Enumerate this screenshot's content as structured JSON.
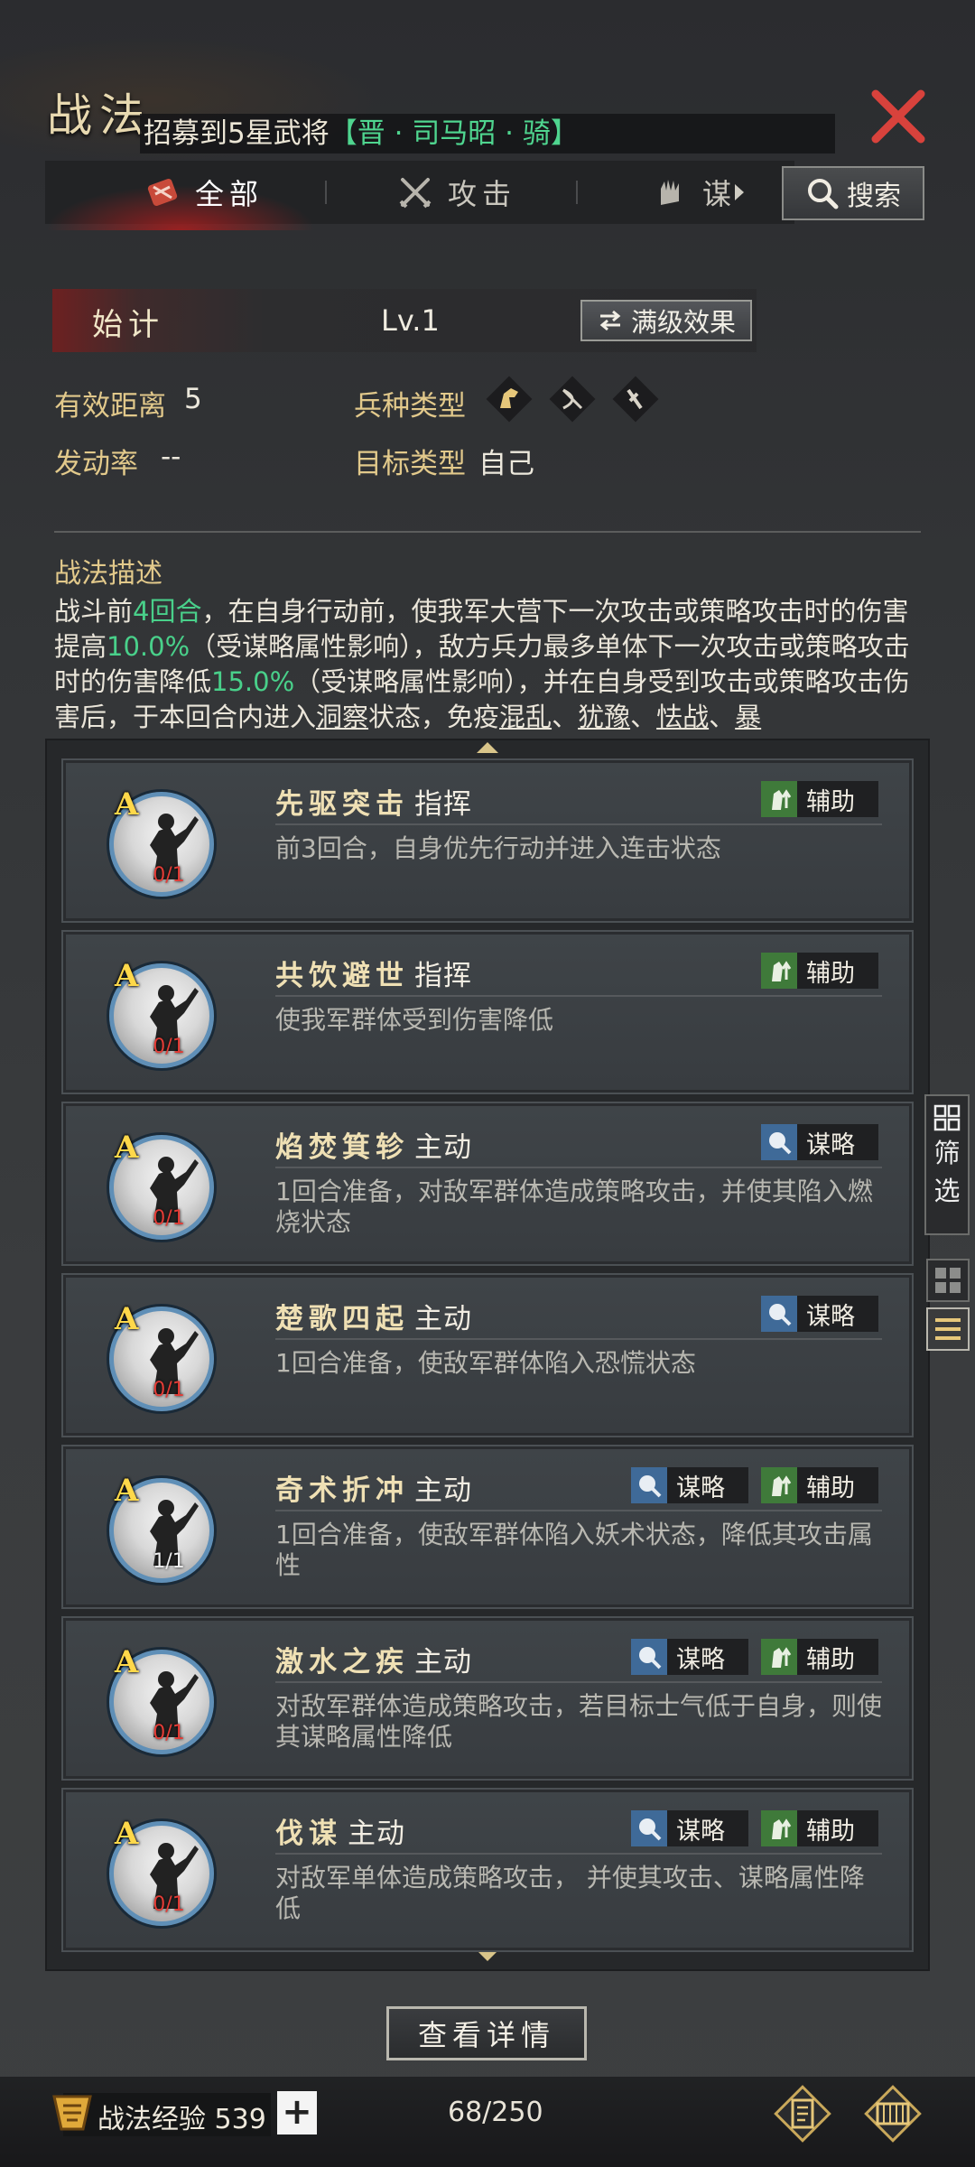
{
  "header": {
    "title": "战法",
    "marquee_prefix": "招募到5星武将",
    "marquee_highlight": "【晋 · 司马昭 · 骑】"
  },
  "tabs": [
    {
      "label": "全部",
      "active": true
    },
    {
      "label": "攻击",
      "active": false
    },
    {
      "label": "谋",
      "active": false
    }
  ],
  "search_label": "搜索",
  "skill": {
    "name": "始计",
    "level": "Lv.1",
    "max_effect_label": "满级效果",
    "range_label": "有效距离",
    "range_value": "5",
    "troop_label": "兵种类型",
    "rate_label": "发动率",
    "rate_value": "--",
    "target_label": "目标类型",
    "target_value": "自己",
    "desc_title": "战法描述",
    "desc_parts": {
      "p1": "战斗前",
      "g1": "4回合",
      "p2": "，在自身行动前，使我军大营下一次攻击或策略攻击时的伤害提高",
      "g2": "10.0%",
      "p3": "（受谋略属性影响），敌方兵力最多单体下一次攻击或策略攻击时的伤害降低",
      "g3": "15.0%",
      "p4": "（受谋略属性影响），并在自身受到攻击或策略攻击伤害后，于本回合内进入",
      "u1": "洞察",
      "p5": "状态，免疫",
      "u2": "混乱",
      "p6": "、",
      "u3": "犹豫",
      "p7": "、",
      "u4": "怯战",
      "p8": "、",
      "u5": "暴"
    }
  },
  "cards": [
    {
      "grade": "A",
      "name": "先驱突击",
      "type": "指挥",
      "desc": "前3回合，自身优先行动并进入连击状态",
      "count": "0/1",
      "tags": [
        "辅助"
      ]
    },
    {
      "grade": "A",
      "name": "共饮避世",
      "type": "指挥",
      "desc": "使我军群体受到伤害降低",
      "count": "0/1",
      "tags": [
        "辅助"
      ]
    },
    {
      "grade": "A",
      "name": "焰焚箕轸",
      "type": "主动",
      "desc": "1回合准备，对敌军群体造成策略攻击，并使其陷入燃烧状态",
      "count": "0/1",
      "tags": [
        "谋略"
      ]
    },
    {
      "grade": "A",
      "name": "楚歌四起",
      "type": "主动",
      "desc": "1回合准备，使敌军群体陷入恐慌状态",
      "count": "0/1",
      "tags": [
        "谋略"
      ]
    },
    {
      "grade": "A",
      "name": "奇术折冲",
      "type": "主动",
      "desc": "1回合准备，使敌军群体陷入妖术状态，降低其攻击属性",
      "count": "1/1",
      "tags": [
        "谋略",
        "辅助"
      ]
    },
    {
      "grade": "A",
      "name": "激水之疾",
      "type": "主动",
      "desc": "对敌军群体造成策略攻击，若目标士气低于自身，则使其谋略属性降低",
      "count": "0/1",
      "tags": [
        "谋略",
        "辅助"
      ]
    },
    {
      "grade": "A",
      "name": "伐谋",
      "type": "主动",
      "desc": "对敌军单体造成策略攻击， 并使其攻击、谋略属性降低",
      "count": "0/1",
      "tags": [
        "谋略",
        "辅助"
      ]
    }
  ],
  "side": {
    "filter_label_1": "筛",
    "filter_label_2": "选"
  },
  "detail_button": "查看详情",
  "bottom": {
    "exp_label": "战法经验",
    "exp_value": "539",
    "plus": "+",
    "capacity": "68/250"
  },
  "colors": {
    "highlight_green": "#49d08a",
    "title_gold": "#e2c98b",
    "close_red": "#d8423c",
    "assist_green": "#3f7a3a",
    "strategy_blue": "#3f6a98"
  }
}
